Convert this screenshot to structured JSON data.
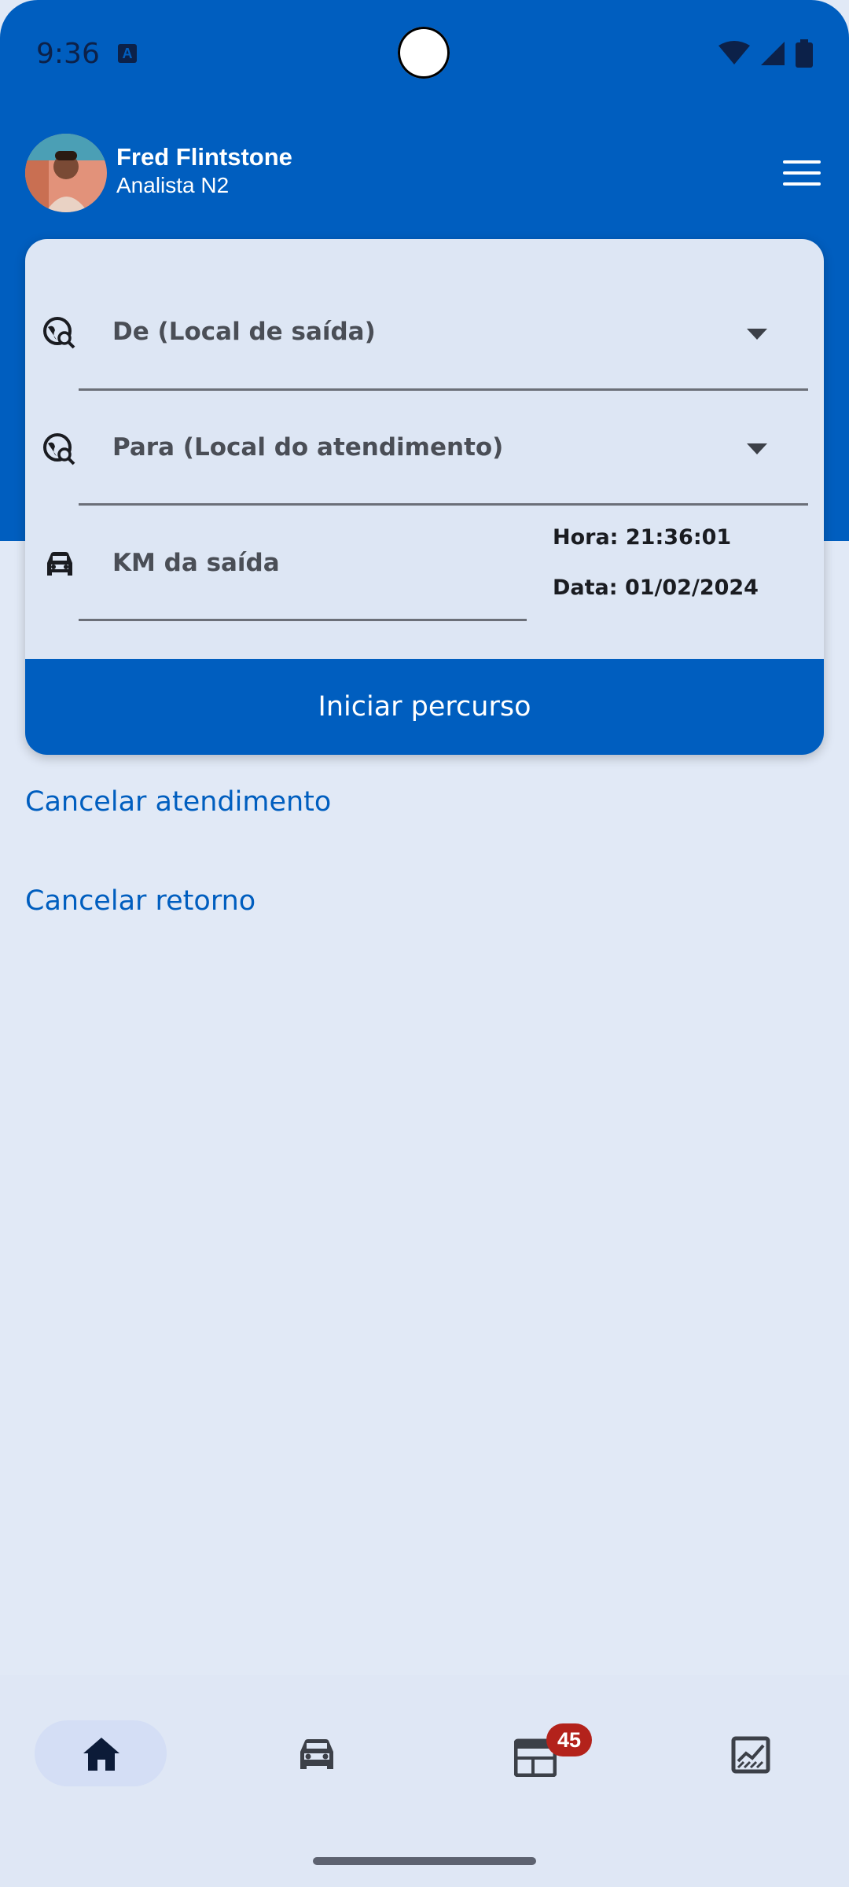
{
  "status_bar": {
    "time": "9:36",
    "notification_icon": "a-icon",
    "icons": [
      "wifi-icon",
      "signal-icon",
      "battery-icon"
    ]
  },
  "header": {
    "user_name": "Fred Flintstone",
    "user_role": "Analista N2",
    "menu_icon": "hamburger-menu-icon"
  },
  "form": {
    "from_label": "De (Local de saída)",
    "to_label": "Para (Local do atendimento)",
    "km_label": "KM da saída",
    "time_text": "Hora: 21:36:01",
    "date_text": "Data: 01/02/2024",
    "start_button": "Iniciar percurso"
  },
  "links": {
    "cancel_service": "Cancelar atendimento",
    "cancel_return": "Cancelar retorno"
  },
  "bottom_nav": {
    "items": [
      {
        "icon": "home-icon",
        "active": true
      },
      {
        "icon": "car-icon",
        "active": false
      },
      {
        "icon": "calendar-icon",
        "active": false,
        "badge": "45"
      },
      {
        "icon": "chart-icon",
        "active": false
      }
    ]
  },
  "colors": {
    "primary": "#005ebf",
    "background": "#e1e9f6",
    "badge": "#b3221b"
  }
}
